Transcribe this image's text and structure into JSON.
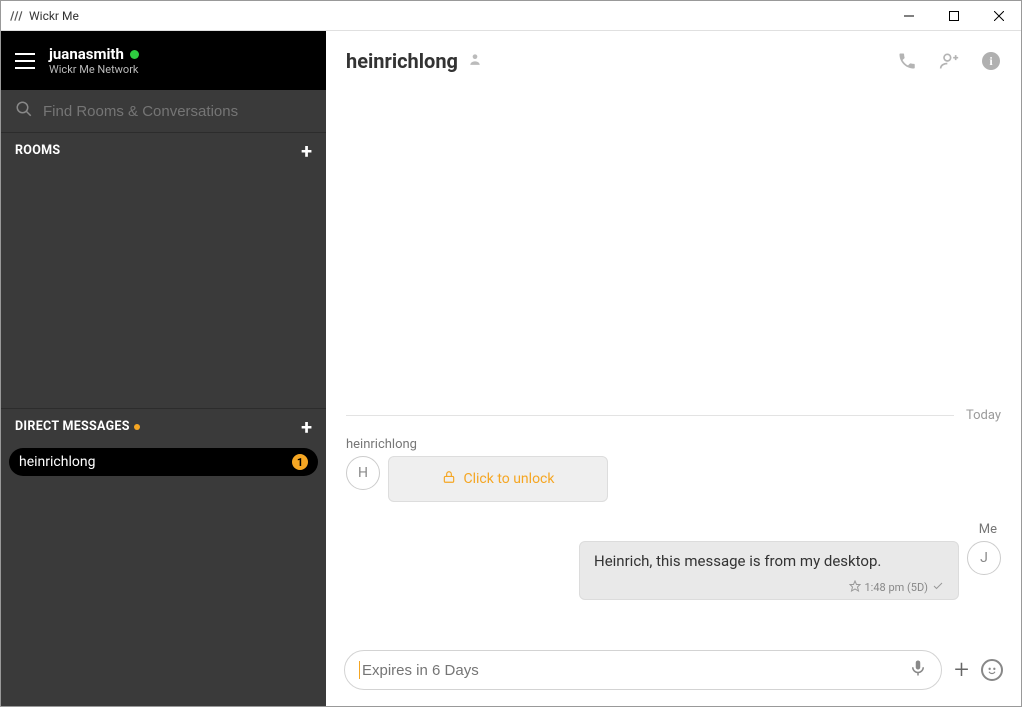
{
  "titlebar": {
    "app_name": "Wickr Me"
  },
  "sidebar": {
    "user": {
      "name": "juanasmith",
      "network": "Wickr Me Network"
    },
    "search": {
      "placeholder": "Find Rooms & Conversations"
    },
    "rooms_label": "ROOMS",
    "dm_label": "DIRECT MESSAGES",
    "dm_items": [
      {
        "name": "heinrichlong",
        "badge": "1"
      }
    ]
  },
  "chat": {
    "title": "heinrichlong",
    "date_label": "Today",
    "messages": {
      "incoming": {
        "sender": "heinrichlong",
        "avatar_letter": "H",
        "unlock_label": "Click to unlock"
      },
      "outgoing": {
        "sender": "Me",
        "avatar_letter": "J",
        "text": "Heinrich, this message is from my desktop.",
        "time": "1:48 pm (5D)"
      }
    },
    "composer": {
      "placeholder": "Expires in 6 Days"
    }
  }
}
